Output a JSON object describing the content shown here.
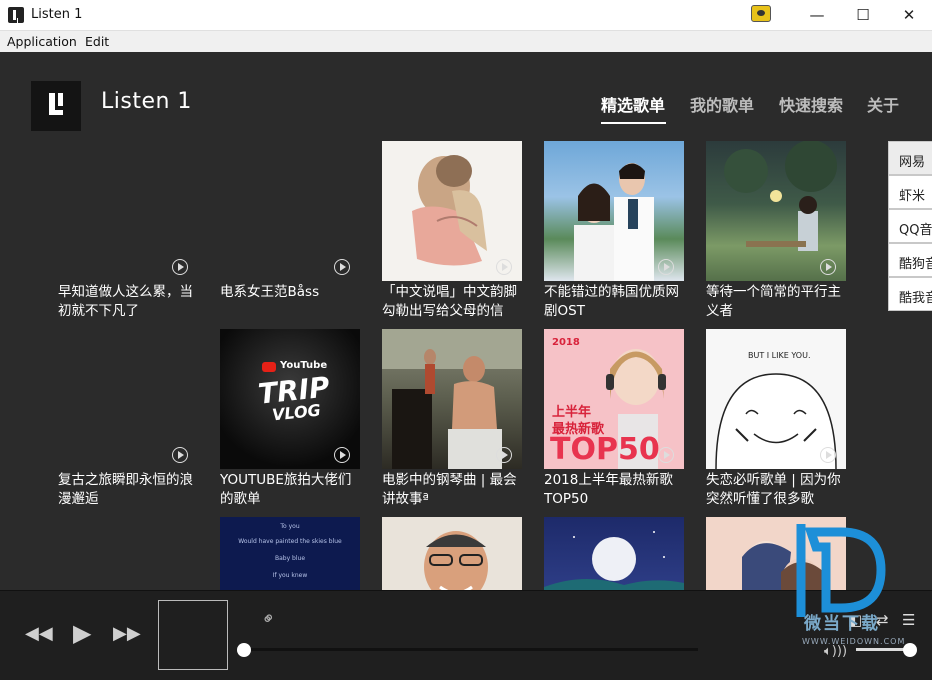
{
  "window": {
    "title": "Listen 1",
    "minimize": "—",
    "maximize": "☐",
    "close": "✕"
  },
  "menu": {
    "application": "Application",
    "edit": "Edit"
  },
  "header": {
    "brand": "Listen 1",
    "nav": [
      "精选歌单",
      "我的歌单",
      "快速搜索",
      "关于"
    ]
  },
  "sources": [
    "网易",
    "虾米",
    "QQ音",
    "酷狗音",
    "酷我音"
  ],
  "playlists": [
    {
      "title": "早知道做人这么累，当初就不下凡了",
      "cover": "none"
    },
    {
      "title": "电系女王范Båss",
      "cover": "none"
    },
    {
      "title": "「中文说唱」中文韵脚勾勒出写给父母的信",
      "cover": "hug"
    },
    {
      "title": "不能错过的韩国优质网剧OST",
      "cover": "couple"
    },
    {
      "title": "等待一个简常的平行主义者",
      "cover": "garden"
    },
    {
      "title": "复古之旅瞬即永恒的浪漫邂逅",
      "cover": "none"
    },
    {
      "title": "YOUTUBE旅拍大佬们的歌单",
      "cover": "trip"
    },
    {
      "title": "电影中的钢琴曲 | 最会讲故事ª",
      "cover": "piano"
    },
    {
      "title": "2018上半年最热新歌TOP50",
      "cover": "top50"
    },
    {
      "title": "失恋必听歌单 | 因为你突然听懂了很多歌",
      "cover": "smile"
    },
    {
      "title": "",
      "cover": "text"
    },
    {
      "title": "",
      "cover": "man"
    },
    {
      "title": "",
      "cover": "moon"
    },
    {
      "title": "",
      "cover": "lovers"
    }
  ],
  "covers": {
    "trip_brand": "YouTube",
    "trip_title": "TRIP",
    "trip_sub": "VLOG",
    "top50_year": "2018",
    "top50_line1": "上半年",
    "top50_line2": "最热新歌",
    "top50_big": "TOP50",
    "smile_caption": "BUT I LIKE YOU.",
    "text_lines": [
      "To you",
      "Would have painted the skies blue",
      "Baby blue",
      "If you knew"
    ]
  },
  "player": {
    "prev": "◀◀",
    "play": "▶",
    "next": "▶▶",
    "progress": 0,
    "volume": 1.0
  },
  "watermark": {
    "text": "微当下载",
    "url": "WWW.WEIDOWN.COM"
  }
}
